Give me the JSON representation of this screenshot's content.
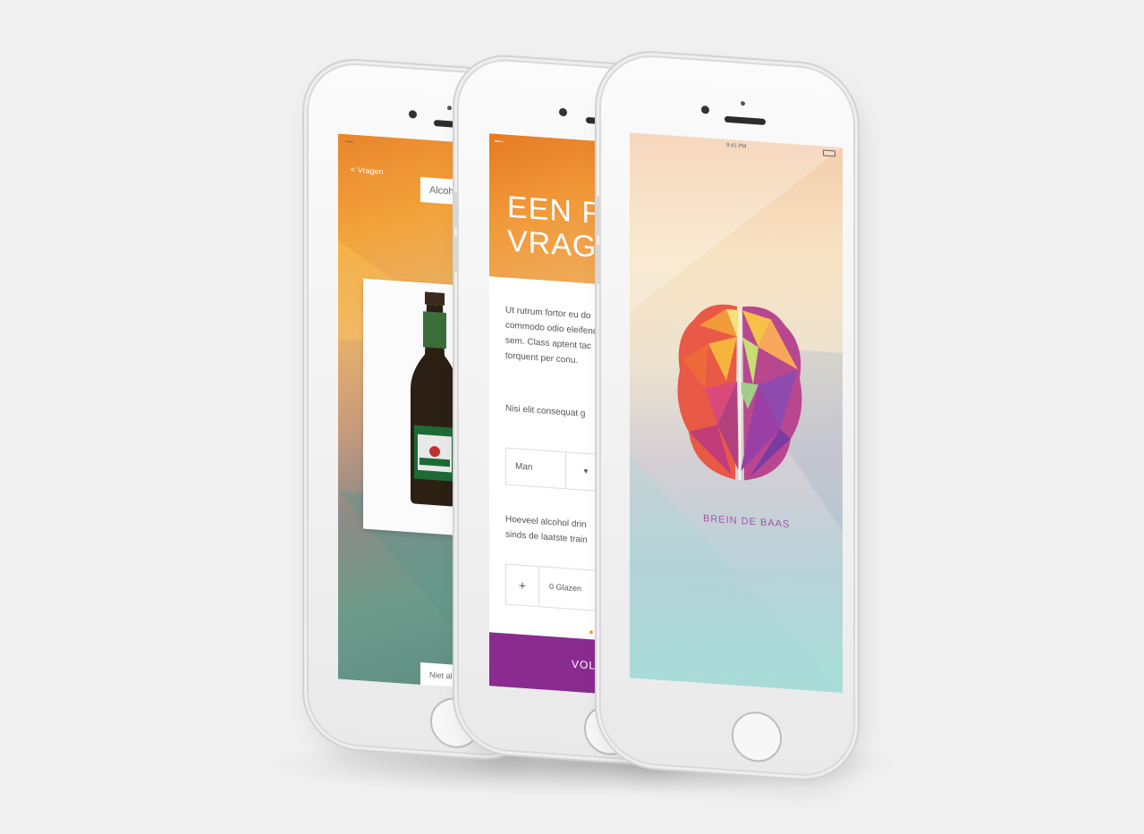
{
  "phone1": {
    "back_label": "< Vragen",
    "tab_label": "Alcoh",
    "bottom_label": "Niet alc"
  },
  "phone2": {
    "title_line1": "EEN PAA",
    "title_line2": "VRAGEN",
    "paragraph": [
      "Ut rutrum fortor eu do",
      "commodo odio eleifend",
      "sem. Class aptent tac",
      "torquent per conu."
    ],
    "question1": "Nisi elit consequat g",
    "select_value": "Man",
    "select_icon": "chevron-down-icon",
    "question2": [
      "Hoeveel alcohol drin",
      "sinds de laatste train"
    ],
    "stepper_sign": "+",
    "stepper_value": "0 Glazen",
    "next_button": "VOLG",
    "accent": "#8a2b8f"
  },
  "phone3": {
    "status_time": "9:41 PM",
    "brand_label": "BREIN DE BAAS",
    "brand_color": "#a550a8"
  }
}
